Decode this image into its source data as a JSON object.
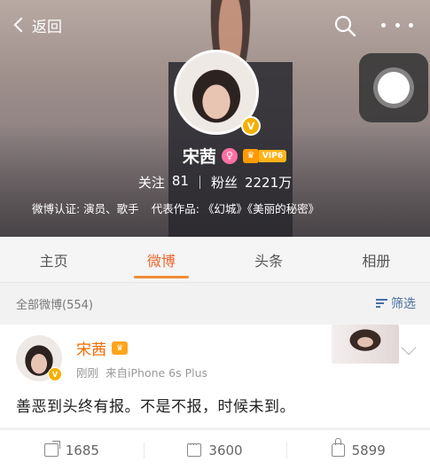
{
  "header": {
    "back_label": "返回",
    "profile": {
      "name": "宋茜",
      "verified_badge": "V",
      "gender_icon": "female-icon",
      "vip_level": "VIP6",
      "following_label": "关注",
      "following_count": "81",
      "followers_label": "粉丝",
      "followers_count": "2221万",
      "verification": "微博认证: 演员、歌手",
      "works": "代表作品: 《幻城》《美丽的秘密》"
    },
    "icons": {
      "search": "search-icon",
      "more": "more-icon",
      "assistive_touch": "assistive-touch-icon"
    }
  },
  "tabs": [
    {
      "label": "主页",
      "active": false
    },
    {
      "label": "微博",
      "active": true
    },
    {
      "label": "头条",
      "active": false
    },
    {
      "label": "相册",
      "active": false
    }
  ],
  "filter": {
    "all_posts": "全部微博(554)",
    "filter_label": "筛选"
  },
  "post": {
    "author": "宋茜",
    "verified_badge": "V",
    "time": "刚刚",
    "source": "来自iPhone 6s Plus",
    "text": "善恶到头终有报。不是不报，时候未到。",
    "actions": {
      "repost_count": "1685",
      "comment_count": "3600",
      "like_count": "5899"
    }
  },
  "colors": {
    "accent": "#e8682f",
    "name_orange": "#f06a00",
    "verified_gold": "#f4b000",
    "link_blue": "#4a6fa5"
  }
}
